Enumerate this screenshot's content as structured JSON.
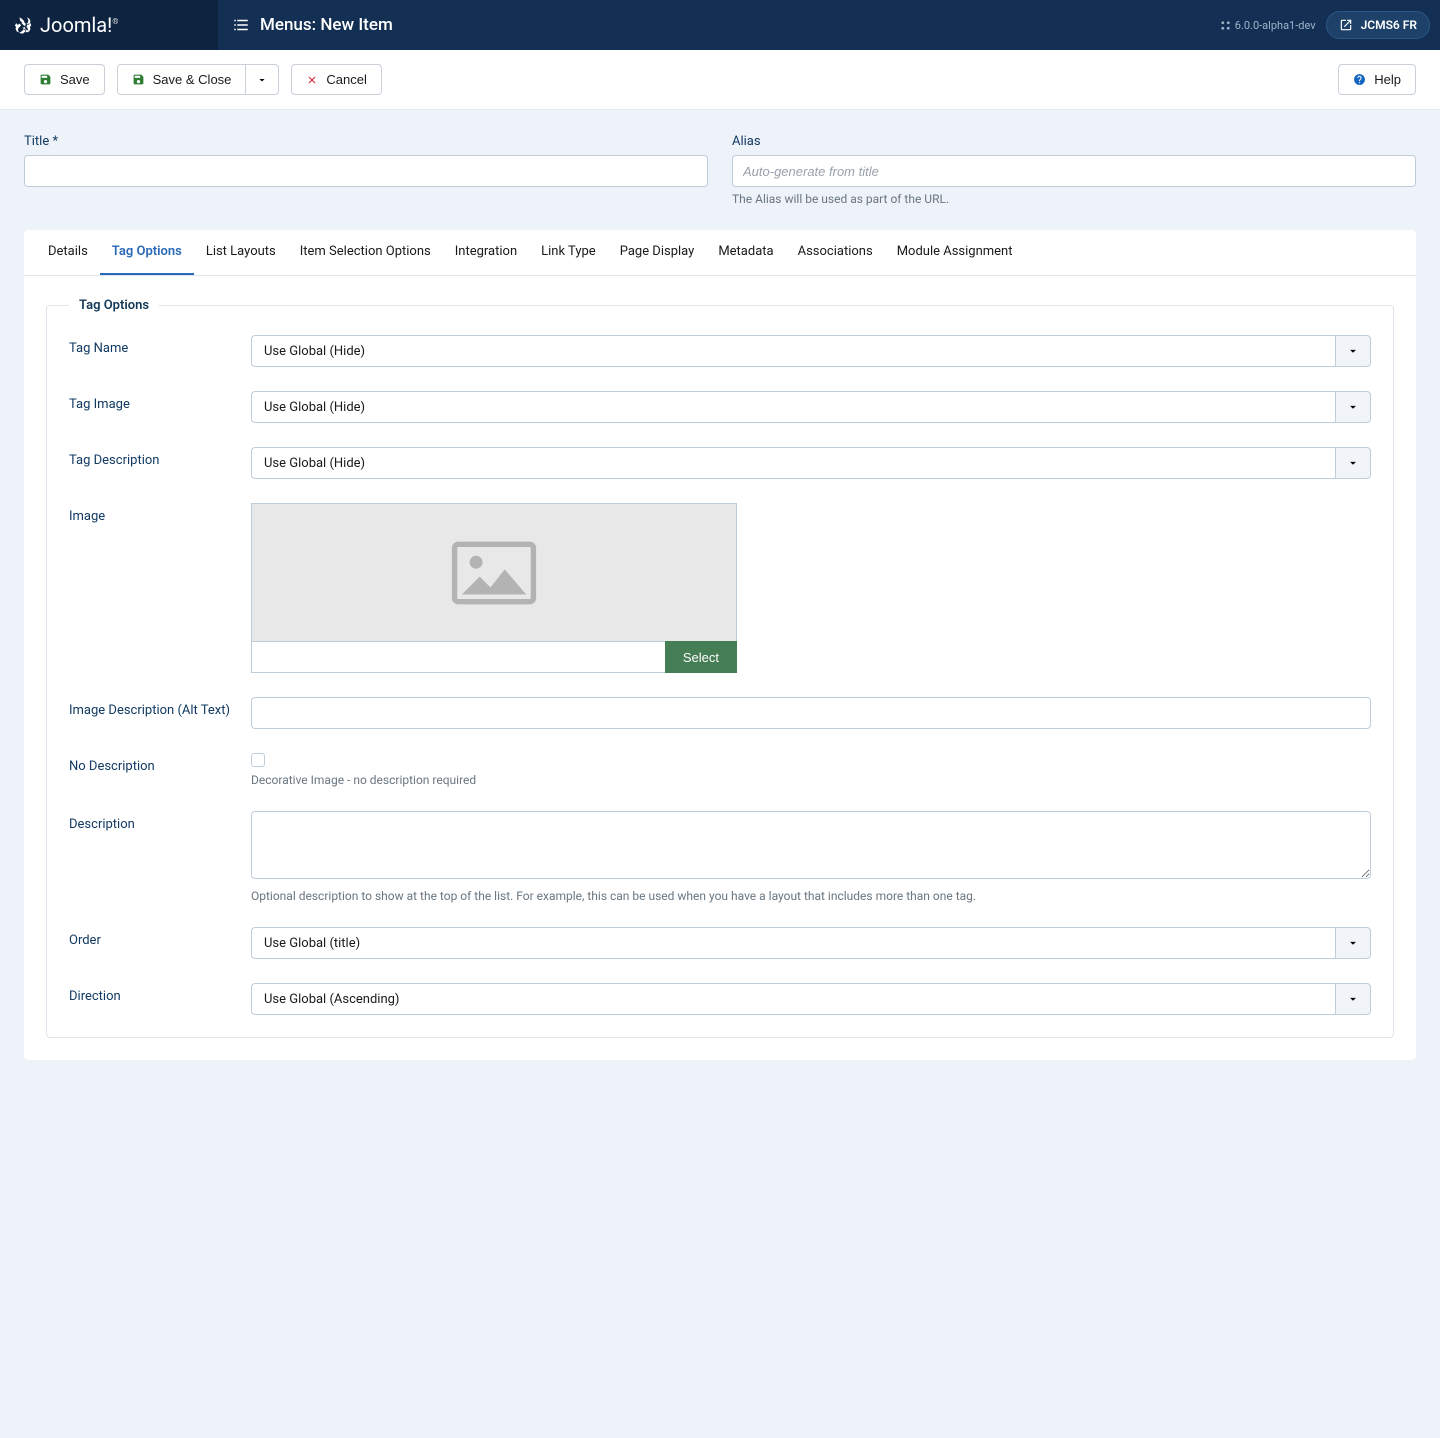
{
  "topbar": {
    "brand": "Joomla!",
    "page_title": "Menus: New Item",
    "version": "6.0.0-alpha1-dev",
    "user_label": "JCMS6 FR"
  },
  "toolbar": {
    "save": "Save",
    "save_close": "Save & Close",
    "cancel": "Cancel",
    "help": "Help"
  },
  "title_alias": {
    "title_label": "Title *",
    "alias_label": "Alias",
    "alias_placeholder": "Auto-generate from title",
    "alias_help": "The Alias will be used as part of the URL."
  },
  "tabs": [
    "Details",
    "Tag Options",
    "List Layouts",
    "Item Selection Options",
    "Integration",
    "Link Type",
    "Page Display",
    "Metadata",
    "Associations",
    "Module Assignment"
  ],
  "fieldset_legend": "Tag Options",
  "form": {
    "tag_name": {
      "label": "Tag Name",
      "value": "Use Global (Hide)"
    },
    "tag_image": {
      "label": "Tag Image",
      "value": "Use Global (Hide)"
    },
    "tag_description": {
      "label": "Tag Description",
      "value": "Use Global (Hide)"
    },
    "image": {
      "label": "Image",
      "select_btn": "Select"
    },
    "alt_text": {
      "label": "Image Description (Alt Text)"
    },
    "no_desc": {
      "label": "No Description",
      "help": "Decorative Image - no description required"
    },
    "description": {
      "label": "Description",
      "help": "Optional description to show at the top of the list. For example, this can be used when you have a layout that includes more than one tag."
    },
    "order": {
      "label": "Order",
      "value": "Use Global (title)"
    },
    "direction": {
      "label": "Direction",
      "value": "Use Global (Ascending)"
    }
  }
}
